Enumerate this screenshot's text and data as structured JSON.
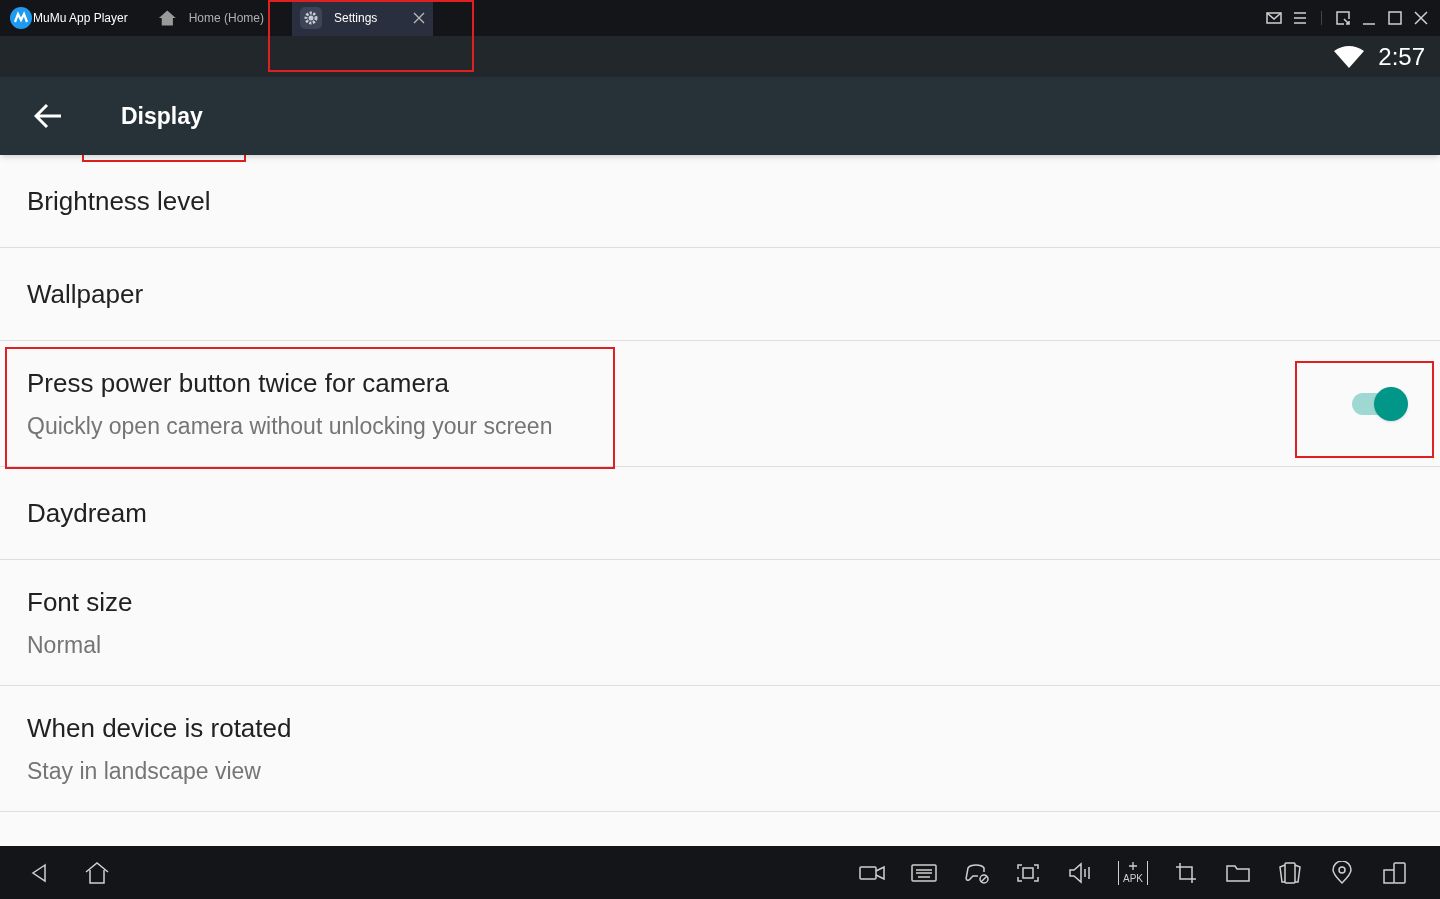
{
  "window": {
    "app_name": "MuMu App Player",
    "tabs": [
      {
        "label": "Home (Home)",
        "kind": "home",
        "selected": false,
        "closable": false
      },
      {
        "label": "Settings",
        "kind": "settings",
        "selected": true,
        "closable": true
      }
    ]
  },
  "status_bar": {
    "time": "2:57"
  },
  "app_bar": {
    "title": "Display"
  },
  "settings": [
    {
      "title": "Brightness level",
      "kind": "plain"
    },
    {
      "title": "Wallpaper",
      "kind": "plain"
    },
    {
      "title": "Press power button twice for camera",
      "subtitle": "Quickly open camera without unlocking your screen",
      "kind": "switch",
      "on": true
    },
    {
      "title": "Daydream",
      "kind": "plain"
    },
    {
      "title": "Font size",
      "subtitle": "Normal",
      "kind": "plain"
    },
    {
      "title": "When device is rotated",
      "subtitle": "Stay in landscape view",
      "kind": "plain"
    }
  ],
  "toolbar": {
    "apk_label": "APK"
  }
}
